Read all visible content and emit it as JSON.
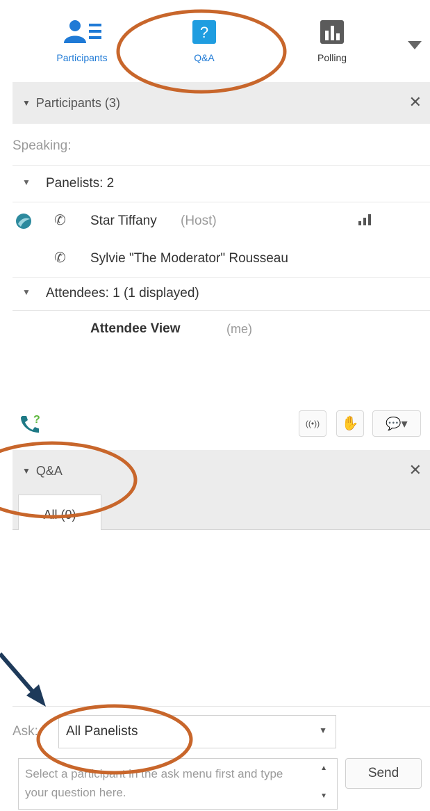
{
  "toolbar": {
    "participants_label": "Participants",
    "qa_label": "Q&A",
    "polling_label": "Polling"
  },
  "participants_section": {
    "title": "Participants (3)",
    "speaking_label": "Speaking:",
    "panelists_label": "Panelists: 2",
    "panelists": [
      {
        "name": "Star Tiffany",
        "role": "(Host)"
      },
      {
        "name": "Sylvie \"The Moderator\" Rousseau",
        "role": ""
      }
    ],
    "attendees_label": "Attendees: 1 (1 displayed)",
    "attendee_name": "Attendee View",
    "attendee_suffix": "(me)"
  },
  "qa_section": {
    "title": "Q&A",
    "tab_all": "All (0)"
  },
  "ask": {
    "label": "Ask:",
    "selected": "All Panelists",
    "placeholder": "Select a participant in the ask menu first and type your question here.",
    "send_label": "Send"
  },
  "colors": {
    "accent_blue": "#1f7ad6",
    "annotation_orange": "#c8662b",
    "arrow_navy": "#1e3a5a",
    "header_gray": "#ececec"
  }
}
